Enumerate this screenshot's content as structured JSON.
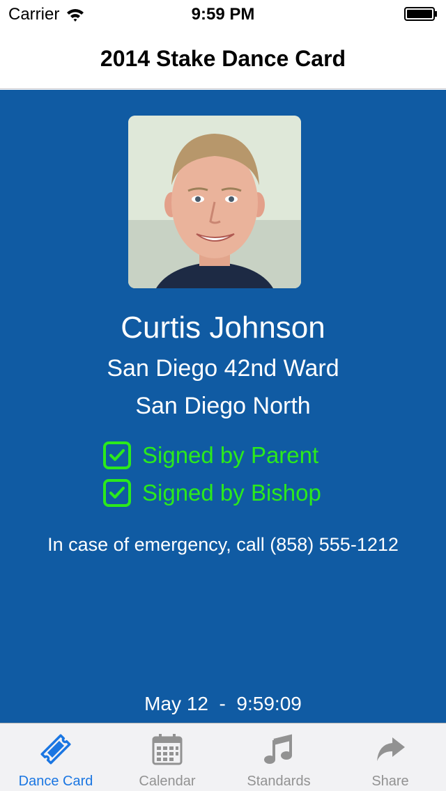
{
  "status_bar": {
    "carrier": "Carrier",
    "time": "9:59 PM",
    "wifi_icon": "wifi-icon",
    "battery_icon": "battery-icon"
  },
  "nav": {
    "title": "2014 Stake Dance Card"
  },
  "card": {
    "background_color": "#105ba3",
    "photo": "profile-photo",
    "name": "Curtis Johnson",
    "ward": "San Diego 42nd Ward",
    "stake": "San Diego North",
    "signatures": [
      {
        "label": "Signed by Parent",
        "checked": true
      },
      {
        "label": "Signed by Bishop",
        "checked": true
      }
    ],
    "signed_color": "#2bea1c",
    "emergency": "In case of emergency, call (858) 555-1212",
    "datetime": "May 12  -  9:59:09"
  },
  "tab_bar": {
    "active_color": "#1a76e2",
    "inactive_color": "#929292",
    "tabs": [
      {
        "label": "Dance Card",
        "icon": "ticket-icon",
        "active": true
      },
      {
        "label": "Calendar",
        "icon": "calendar-icon",
        "active": false
      },
      {
        "label": "Standards",
        "icon": "music-note-icon",
        "active": false
      },
      {
        "label": "Share",
        "icon": "share-arrow-icon",
        "active": false
      }
    ]
  }
}
